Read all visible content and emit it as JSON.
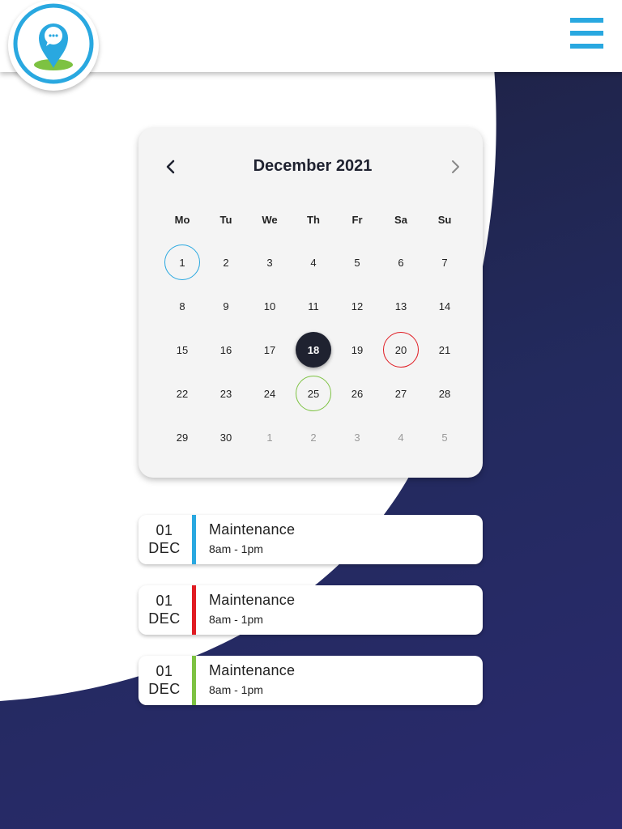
{
  "colors": {
    "accent_blue": "#29a8e0",
    "accent_red": "#e01b22",
    "accent_green": "#7dc242",
    "dark": "#1f2230",
    "navy_bg": "#232a5e"
  },
  "header": {
    "logo_icon": "map-pin-chat-icon",
    "menu_icon": "hamburger-menu-icon"
  },
  "calendar": {
    "title": "December 2021",
    "prev_icon": "chevron-left-icon",
    "next_icon": "chevron-right-icon",
    "weekdays": [
      "Mo",
      "Tu",
      "We",
      "Th",
      "Fr",
      "Sa",
      "Su"
    ],
    "days": [
      {
        "label": "1",
        "state": "ring-blue"
      },
      {
        "label": "2"
      },
      {
        "label": "3"
      },
      {
        "label": "4"
      },
      {
        "label": "5"
      },
      {
        "label": "6"
      },
      {
        "label": "7"
      },
      {
        "label": "8"
      },
      {
        "label": "9"
      },
      {
        "label": "10"
      },
      {
        "label": "11"
      },
      {
        "label": "12"
      },
      {
        "label": "13"
      },
      {
        "label": "14"
      },
      {
        "label": "15"
      },
      {
        "label": "16"
      },
      {
        "label": "17"
      },
      {
        "label": "18",
        "state": "selected"
      },
      {
        "label": "19"
      },
      {
        "label": "20",
        "state": "ring-red"
      },
      {
        "label": "21"
      },
      {
        "label": "22"
      },
      {
        "label": "23"
      },
      {
        "label": "24"
      },
      {
        "label": "25",
        "state": "ring-green"
      },
      {
        "label": "26"
      },
      {
        "label": "27"
      },
      {
        "label": "28"
      },
      {
        "label": "29"
      },
      {
        "label": "30"
      },
      {
        "label": "1",
        "state": "muted"
      },
      {
        "label": "2",
        "state": "muted"
      },
      {
        "label": "3",
        "state": "muted"
      },
      {
        "label": "4",
        "state": "muted"
      },
      {
        "label": "5",
        "state": "muted"
      }
    ]
  },
  "events": [
    {
      "day": "01",
      "month": "DEC",
      "title": "Maintenance",
      "time": "8am - 1pm",
      "color": "#29a8e0"
    },
    {
      "day": "01",
      "month": "DEC",
      "title": "Maintenance",
      "time": "8am - 1pm",
      "color": "#e01b22"
    },
    {
      "day": "01",
      "month": "DEC",
      "title": "Maintenance",
      "time": "8am - 1pm",
      "color": "#7dc242"
    }
  ]
}
